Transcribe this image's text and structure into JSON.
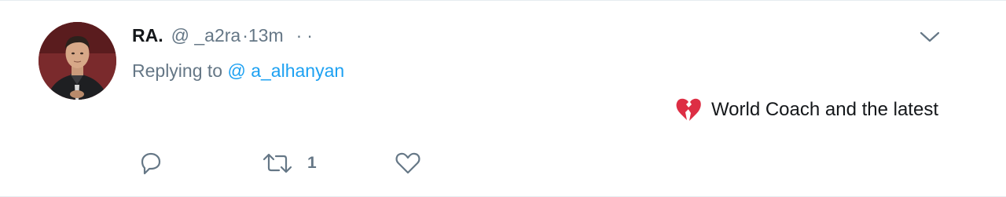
{
  "tweet": {
    "author_name": "RA.",
    "handle": "@ _a2ra",
    "time": "·13m",
    "more_dots": "··",
    "replying_prefix": "Replying to",
    "replying_to": "@ a_alhanyan",
    "text": "World Coach and the latest",
    "emoji": "broken-heart"
  },
  "actions": {
    "reply": {
      "icon": "reply-icon",
      "count": ""
    },
    "retweet": {
      "icon": "retweet-icon",
      "count": "1"
    },
    "like": {
      "icon": "heart-icon",
      "count": ""
    }
  },
  "colors": {
    "text_primary": "#14171a",
    "text_secondary": "#657786",
    "link": "#1da1f2",
    "icon": "#657786",
    "emoji_red": "#dd2e44",
    "border": "#e6ecf0"
  }
}
